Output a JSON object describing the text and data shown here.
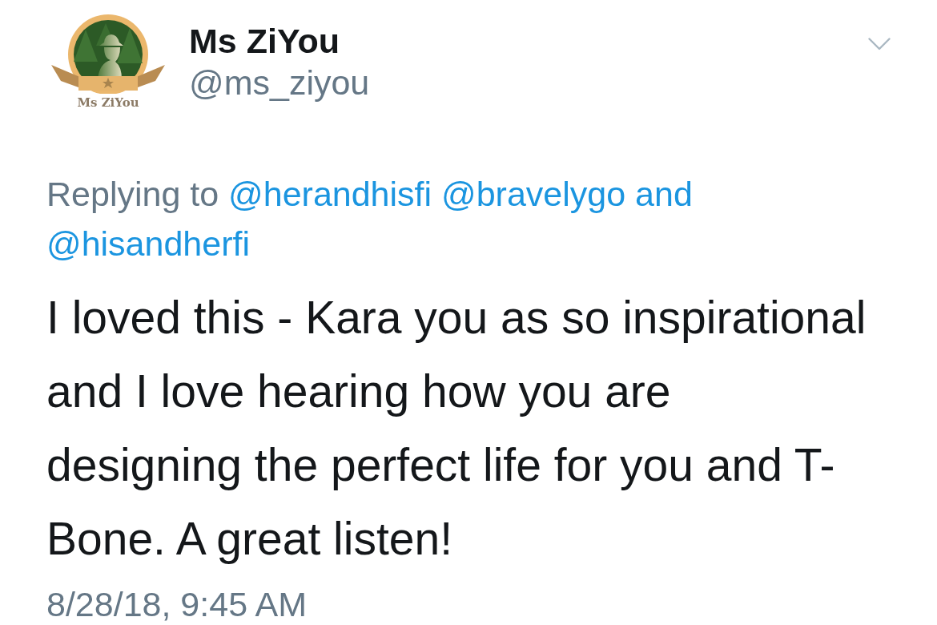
{
  "tweet": {
    "author": {
      "avatar": {
        "logo_text": "Ms ZiYou"
      },
      "name": "Ms ZiYou",
      "handle": "@ms_ziyou"
    },
    "replying_to": {
      "prefix": "Replying to",
      "users": [
        "@herandhisfi",
        "@bravelygo",
        "@hisandherfi"
      ],
      "conjunction": "and"
    },
    "text": "I loved this - Kara you as so inspirational and I love hearing how you are designing the perfect life for you and T-Bone. A great listen!",
    "timestamp": "8/28/18, 9:45 AM"
  }
}
